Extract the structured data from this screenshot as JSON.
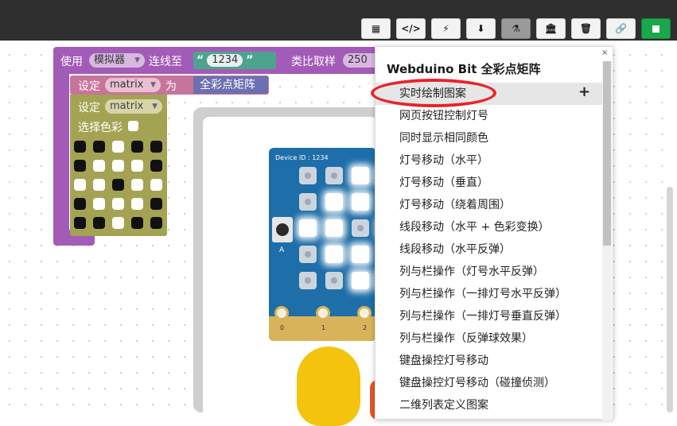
{
  "toolbar": {
    "buttons": [
      {
        "name": "qr-code-icon",
        "glyph": "▦"
      },
      {
        "name": "code-icon",
        "glyph": "</>"
      },
      {
        "name": "flash-icon",
        "glyph": "⚡"
      },
      {
        "name": "download-box-icon",
        "glyph": "⬇"
      },
      {
        "name": "flask-icon",
        "glyph": "⚗"
      },
      {
        "name": "library-icon",
        "glyph": "🏛"
      },
      {
        "name": "trash-icon",
        "glyph": "🗑"
      },
      {
        "name": "link-icon",
        "glyph": "🔗"
      }
    ],
    "run_icon": "stop-square-icon"
  },
  "blocks": {
    "use_label": "使用",
    "simulator_value": "模拟器",
    "connect_label": "连线至",
    "device_id": "1234",
    "quote_open": "“",
    "quote_close": "”",
    "ratio_label": "类比取样",
    "ratio_value": "250",
    "set_label": "设定",
    "var_name": "matrix",
    "as_label": "为",
    "fn_label": "全彩点矩阵",
    "set_label2": "设定",
    "var_name2": "matrix",
    "color_label": "选择色彩"
  },
  "board": {
    "device_label": "Device ID : 1234",
    "button_label": "A",
    "pins": [
      "0",
      "1",
      "2"
    ]
  },
  "menu": {
    "title": "Webduino Bit 全彩点矩阵",
    "close_glyph": "×",
    "plus": "+",
    "items": [
      "实时绘制图案",
      "网页按钮控制灯号",
      "同时显示相同颜色",
      "灯号移动（水平）",
      "灯号移动（垂直）",
      "灯号移动（绕着周围）",
      "线段移动（水平 + 色彩变换）",
      "线段移动（水平反弹）",
      "列与栏操作（灯号水平反弹）",
      "列与栏操作（一排灯号水平反弹）",
      "列与栏操作（一排灯号垂直反弹）",
      "列与栏操作（反弹球效果）",
      "键盘操控灯号移动",
      "键盘操控灯号移动（碰撞侦测）",
      "二维列表定义图案"
    ],
    "selected_index": 0
  },
  "colors": {
    "purple_block": "#a35bb8",
    "olive_block": "#a3a353",
    "board_blue": "#1e6fa9",
    "annotation_red": "#e8232a",
    "run_green": "#1aa84a"
  }
}
